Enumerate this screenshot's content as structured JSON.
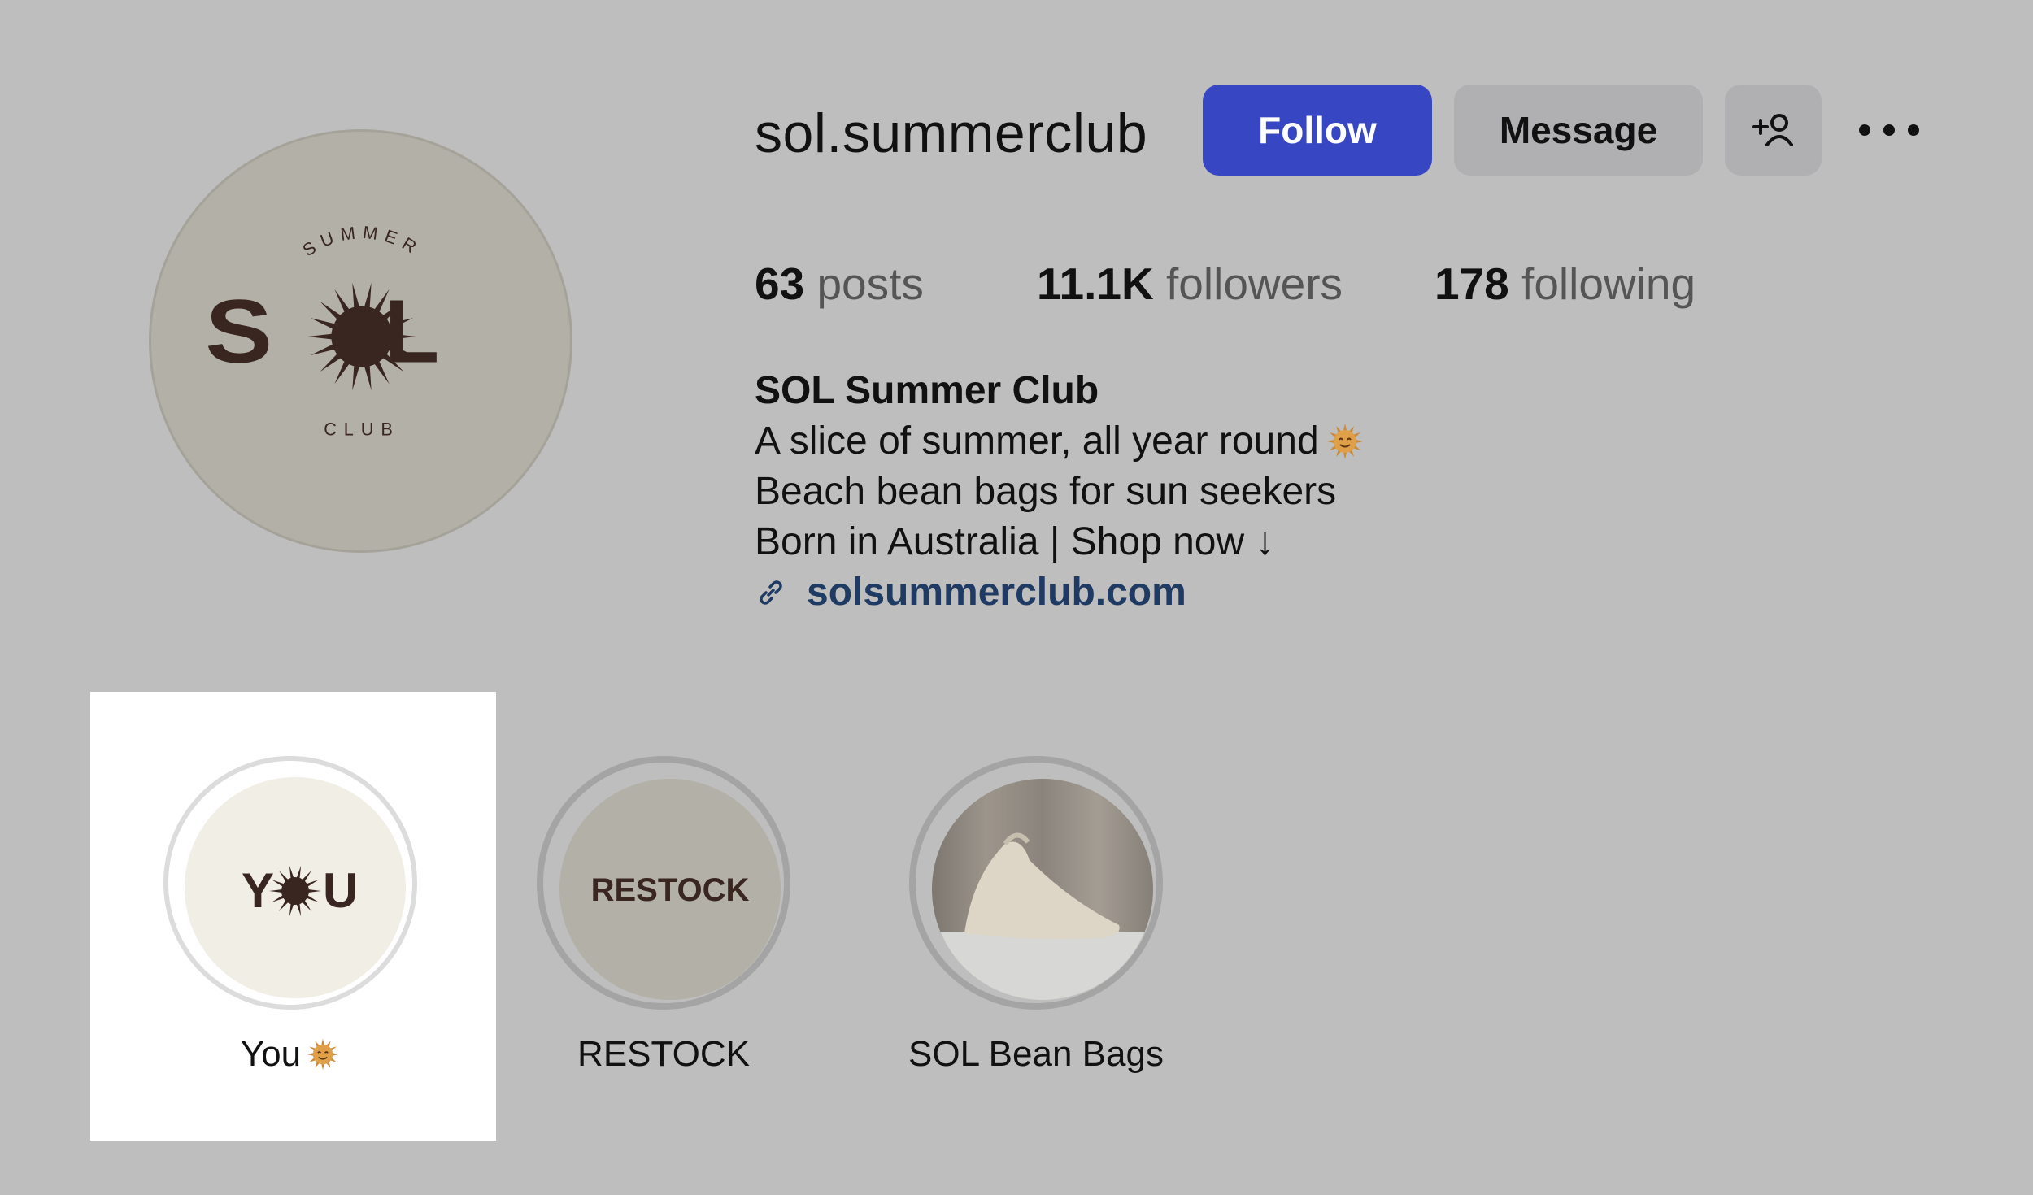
{
  "profile": {
    "username": "sol.summerclub",
    "logo_text": {
      "top": "SUMMER",
      "main_left": "S",
      "main_right": "L",
      "bottom": "CLUB"
    }
  },
  "actions": {
    "follow_label": "Follow",
    "message_label": "Message",
    "add_user_icon": "person-add-icon",
    "more_icon": "more-horizontal-icon"
  },
  "stats": {
    "posts": {
      "value": "63",
      "label": "posts"
    },
    "followers": {
      "value": "11.1K",
      "label": "followers"
    },
    "following": {
      "value": "178",
      "label": "following"
    }
  },
  "bio": {
    "name": "SOL Summer Club",
    "lines": [
      "A slice of summer, all year round",
      "Beach bean bags for sun seekers",
      "Born in Australia | Shop now ↓"
    ],
    "link": "solsummerclub.com",
    "link_icon": "link-icon"
  },
  "highlights": [
    {
      "label": "You",
      "cover_text": "Y U",
      "selected": true
    },
    {
      "label": "RESTOCK",
      "cover_text": "RESTOCK",
      "selected": false
    },
    {
      "label": "SOL Bean Bags",
      "cover_text": "",
      "selected": false
    }
  ],
  "colors": {
    "background": "#bebebe",
    "follow_button": "#3747c4",
    "secondary_button": "#b0b0b3",
    "logo_brown": "#3a2620",
    "link": "#1f3a63"
  }
}
